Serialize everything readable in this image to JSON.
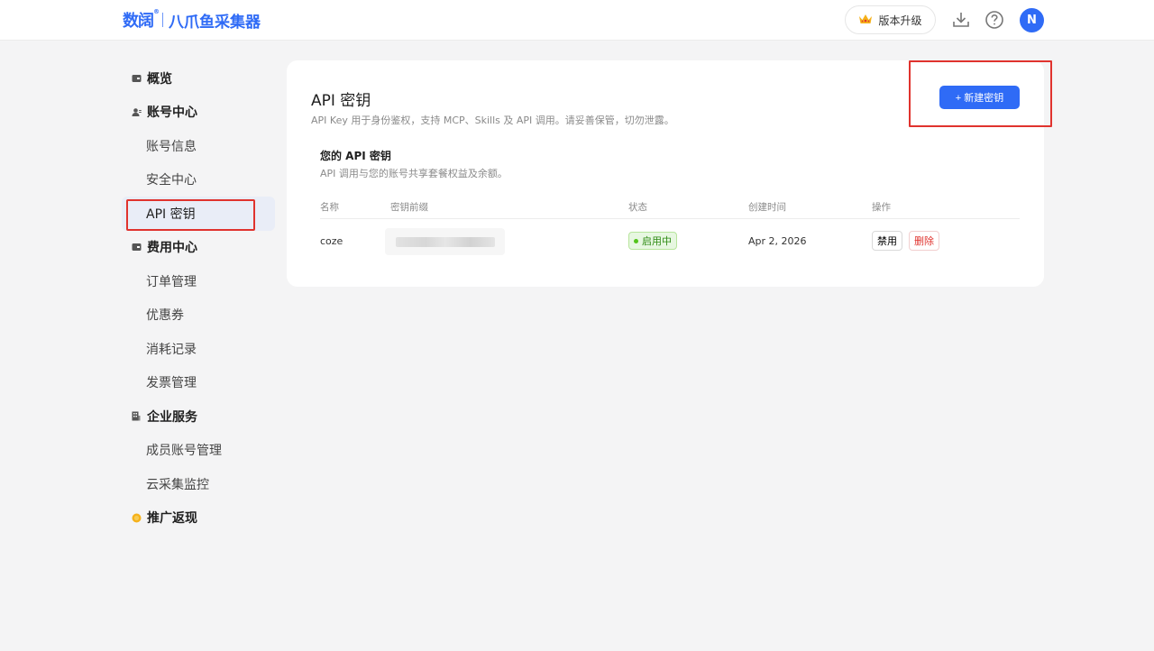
{
  "header": {
    "logo_mark": "数阔",
    "logo_registered": "®",
    "app_name": "八爪鱼采集器",
    "upgrade_label": "版本升级",
    "avatar_initial": "N",
    "icons": [
      "crown-icon",
      "download-icon",
      "help-icon"
    ]
  },
  "sidebar": {
    "groups": [
      {
        "label": "概览",
        "icon": "wallet-icon"
      },
      {
        "label": "账号中心",
        "icon": "user-icon",
        "items": [
          "账号信息",
          "安全中心",
          "API 密钥"
        ]
      },
      {
        "label": "费用中心",
        "icon": "wallet-icon",
        "items": [
          "订单管理",
          "优惠券",
          "消耗记录",
          "发票管理"
        ]
      },
      {
        "label": "企业服务",
        "icon": "building-icon",
        "items": [
          "成员账号管理",
          "云采集监控"
        ]
      },
      {
        "label": "推广返现",
        "icon": "coin-icon"
      }
    ],
    "active_item": "API 密钥"
  },
  "main": {
    "title": "API 密钥",
    "description": "API Key 用于身份鉴权，支持 MCP、Skills 及 API 调用。请妥善保管，切勿泄露。",
    "new_button_label": "+ 新建密钥",
    "section_title": "您的 API 密钥",
    "section_description": "API 调用与您的账号共享套餐权益及余额。",
    "columns": [
      "名称",
      "密钥前缀",
      "状态",
      "创建时间",
      "操作"
    ],
    "rows": [
      {
        "name": "coze",
        "prefix": "",
        "status": "启用中",
        "created": "Apr 2, 2026",
        "actions": [
          "禁用",
          "删除"
        ]
      }
    ]
  },
  "colors": {
    "primary": "#2f6bf6",
    "highlight": "#e0332e",
    "status_green": "#52c41a",
    "danger": "#e0332e"
  }
}
